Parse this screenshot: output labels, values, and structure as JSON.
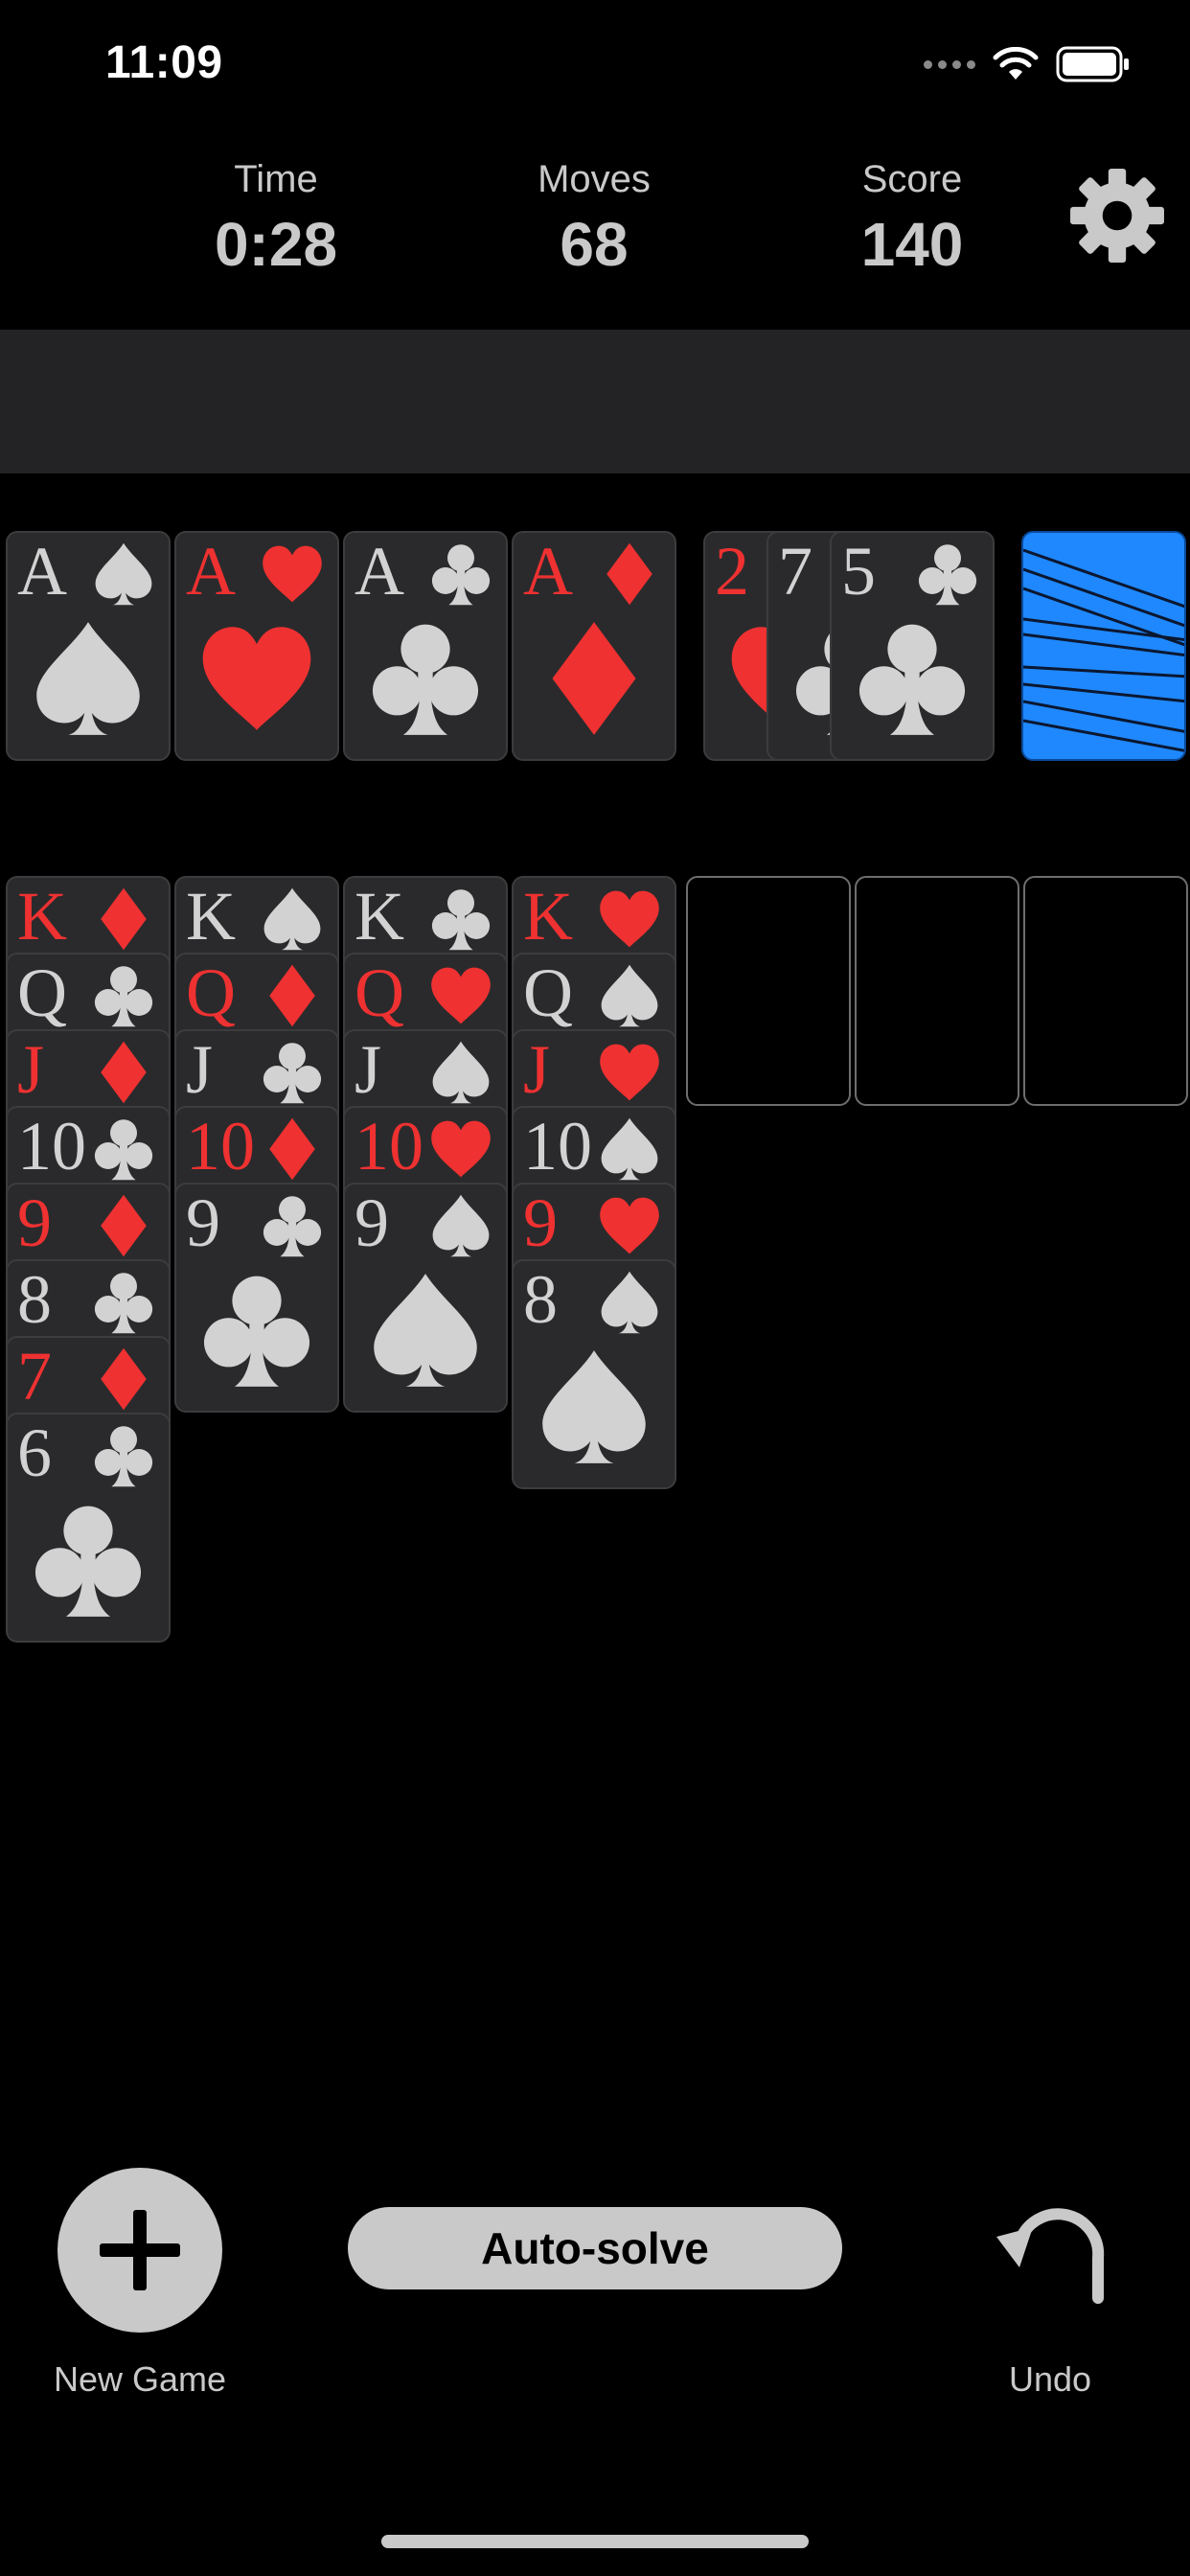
{
  "status_bar": {
    "time": "11:09"
  },
  "stats": [
    {
      "label": "Time",
      "value": "0:28"
    },
    {
      "label": "Moves",
      "value": "68"
    },
    {
      "label": "Score",
      "value": "140"
    }
  ],
  "settings_icon": "gear-icon",
  "foundations": [
    {
      "rank": "A",
      "suit": "spades"
    },
    {
      "rank": "A",
      "suit": "hearts"
    },
    {
      "rank": "A",
      "suit": "clubs"
    },
    {
      "rank": "A",
      "suit": "diamonds"
    }
  ],
  "waste": [
    {
      "rank": "2",
      "suit": "hearts"
    },
    {
      "rank": "7",
      "suit": "clubs"
    },
    {
      "rank": "5",
      "suit": "clubs"
    }
  ],
  "stock": {
    "face_down": true,
    "color": "#1f88ff"
  },
  "tableau": [
    [
      {
        "rank": "K",
        "suit": "diamonds"
      },
      {
        "rank": "Q",
        "suit": "clubs"
      },
      {
        "rank": "J",
        "suit": "diamonds"
      },
      {
        "rank": "10",
        "suit": "clubs"
      },
      {
        "rank": "9",
        "suit": "diamonds"
      },
      {
        "rank": "8",
        "suit": "clubs"
      },
      {
        "rank": "7",
        "suit": "diamonds"
      },
      {
        "rank": "6",
        "suit": "clubs"
      }
    ],
    [
      {
        "rank": "K",
        "suit": "spades"
      },
      {
        "rank": "Q",
        "suit": "diamonds"
      },
      {
        "rank": "J",
        "suit": "clubs"
      },
      {
        "rank": "10",
        "suit": "diamonds"
      },
      {
        "rank": "9",
        "suit": "clubs"
      }
    ],
    [
      {
        "rank": "K",
        "suit": "clubs"
      },
      {
        "rank": "Q",
        "suit": "hearts"
      },
      {
        "rank": "J",
        "suit": "spades"
      },
      {
        "rank": "10",
        "suit": "hearts"
      },
      {
        "rank": "9",
        "suit": "spades"
      }
    ],
    [
      {
        "rank": "K",
        "suit": "hearts"
      },
      {
        "rank": "Q",
        "suit": "spades"
      },
      {
        "rank": "J",
        "suit": "hearts"
      },
      {
        "rank": "10",
        "suit": "spades"
      },
      {
        "rank": "9",
        "suit": "hearts"
      },
      {
        "rank": "8",
        "suit": "spades"
      }
    ],
    [],
    [],
    []
  ],
  "colors": {
    "red": "#ef3131",
    "black_suit": "#d2d2d2",
    "card_face": "#2a2a2c",
    "banner": "#232325",
    "button": "#c9c9c9"
  },
  "footer": {
    "new_game_label": "New Game",
    "new_game_icon": "plus-icon",
    "autosolve_label": "Auto-solve",
    "undo_label": "Undo",
    "undo_icon": "undo-arrow-icon"
  }
}
